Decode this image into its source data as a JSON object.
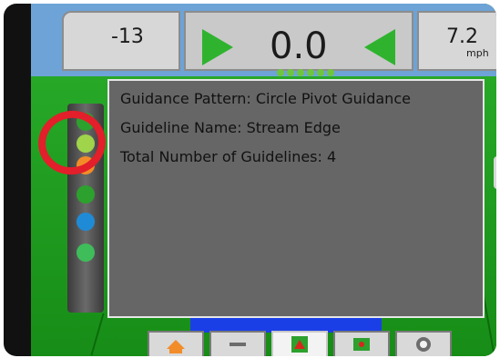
{
  "header": {
    "left_value": "-13",
    "center_value": "0.0",
    "right_value": "7.2",
    "right_unit": "mph"
  },
  "info_panel": {
    "lines": [
      "Guidance Pattern: Circle Pivot Guidance",
      "Guideline Name: Stream Edge",
      "Total Number of Guidelines: 4"
    ]
  },
  "icons": {
    "left_strip": [
      "guidance-icon",
      "target-icon",
      "field-icon",
      "steering-icon",
      "marker-icon",
      "drop-icon"
    ],
    "bottom_bar": [
      "home-icon",
      "tools-icon",
      "guidance-view-icon",
      "field-flag-icon",
      "camera-icon"
    ],
    "compass": "compass-icon"
  },
  "colors": {
    "accent_green": "#2fb32f",
    "panel_bg": "#666666",
    "highlight_red": "#e21f2a"
  }
}
